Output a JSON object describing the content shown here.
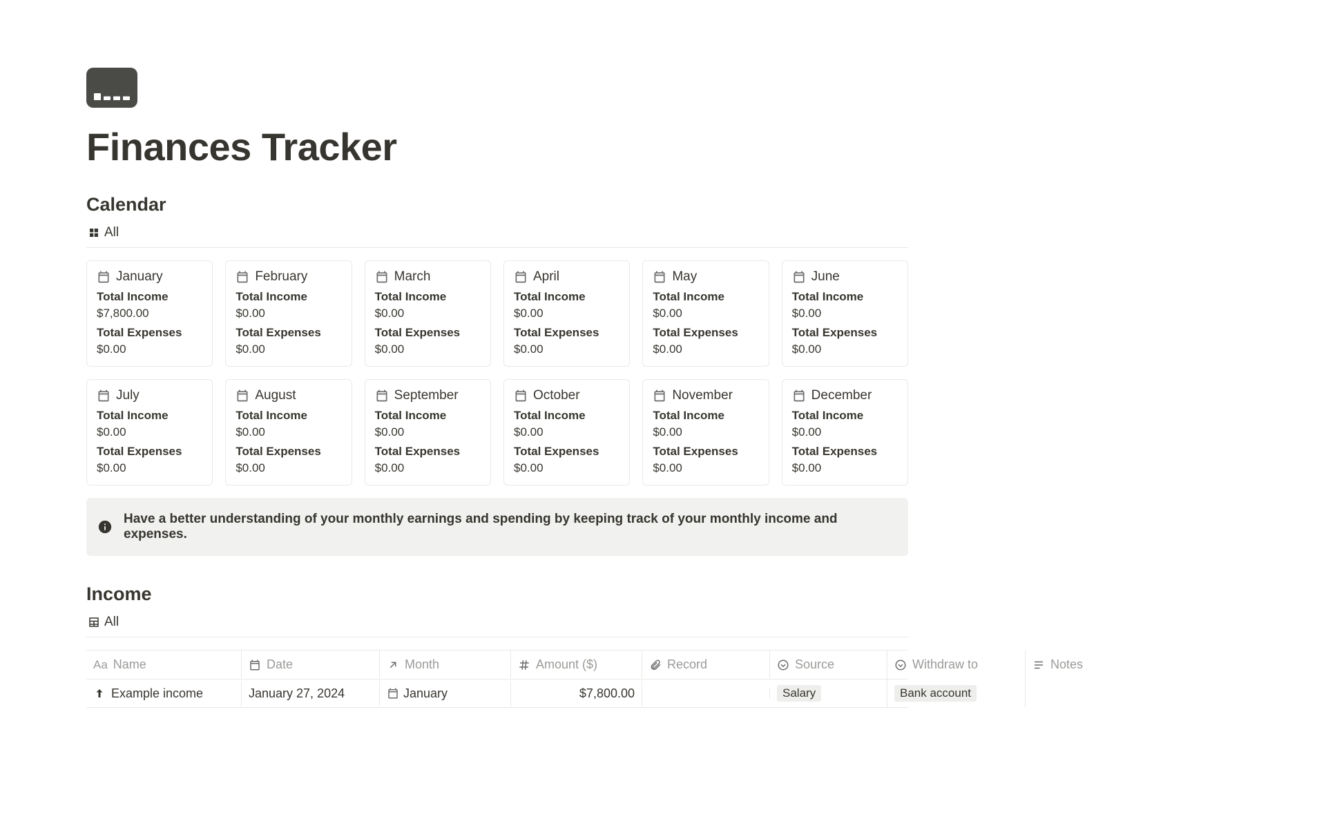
{
  "page": {
    "title": "Finances Tracker"
  },
  "calendar": {
    "heading": "Calendar",
    "view_label": "All",
    "income_label": "Total Income",
    "expenses_label": "Total Expenses",
    "months": [
      {
        "name": "January",
        "income": "$7,800.00",
        "expenses": "$0.00"
      },
      {
        "name": "February",
        "income": "$0.00",
        "expenses": "$0.00"
      },
      {
        "name": "March",
        "income": "$0.00",
        "expenses": "$0.00"
      },
      {
        "name": "April",
        "income": "$0.00",
        "expenses": "$0.00"
      },
      {
        "name": "May",
        "income": "$0.00",
        "expenses": "$0.00"
      },
      {
        "name": "June",
        "income": "$0.00",
        "expenses": "$0.00"
      },
      {
        "name": "July",
        "income": "$0.00",
        "expenses": "$0.00"
      },
      {
        "name": "August",
        "income": "$0.00",
        "expenses": "$0.00"
      },
      {
        "name": "September",
        "income": "$0.00",
        "expenses": "$0.00"
      },
      {
        "name": "October",
        "income": "$0.00",
        "expenses": "$0.00"
      },
      {
        "name": "November",
        "income": "$0.00",
        "expenses": "$0.00"
      },
      {
        "name": "December",
        "income": "$0.00",
        "expenses": "$0.00"
      }
    ]
  },
  "callout": {
    "text": "Have a better understanding of your monthly earnings and spending by keeping track of your monthly income and expenses."
  },
  "income": {
    "heading": "Income",
    "view_label": "All",
    "columns": {
      "name": "Name",
      "date": "Date",
      "month": "Month",
      "amount": "Amount ($)",
      "record": "Record",
      "source": "Source",
      "withdraw": "Withdraw to",
      "notes": "Notes"
    },
    "rows": [
      {
        "name": "Example income",
        "date": "January 27, 2024",
        "month": "January",
        "amount": "$7,800.00",
        "record": "",
        "source": "Salary",
        "withdraw": "Bank account",
        "notes": ""
      }
    ]
  }
}
